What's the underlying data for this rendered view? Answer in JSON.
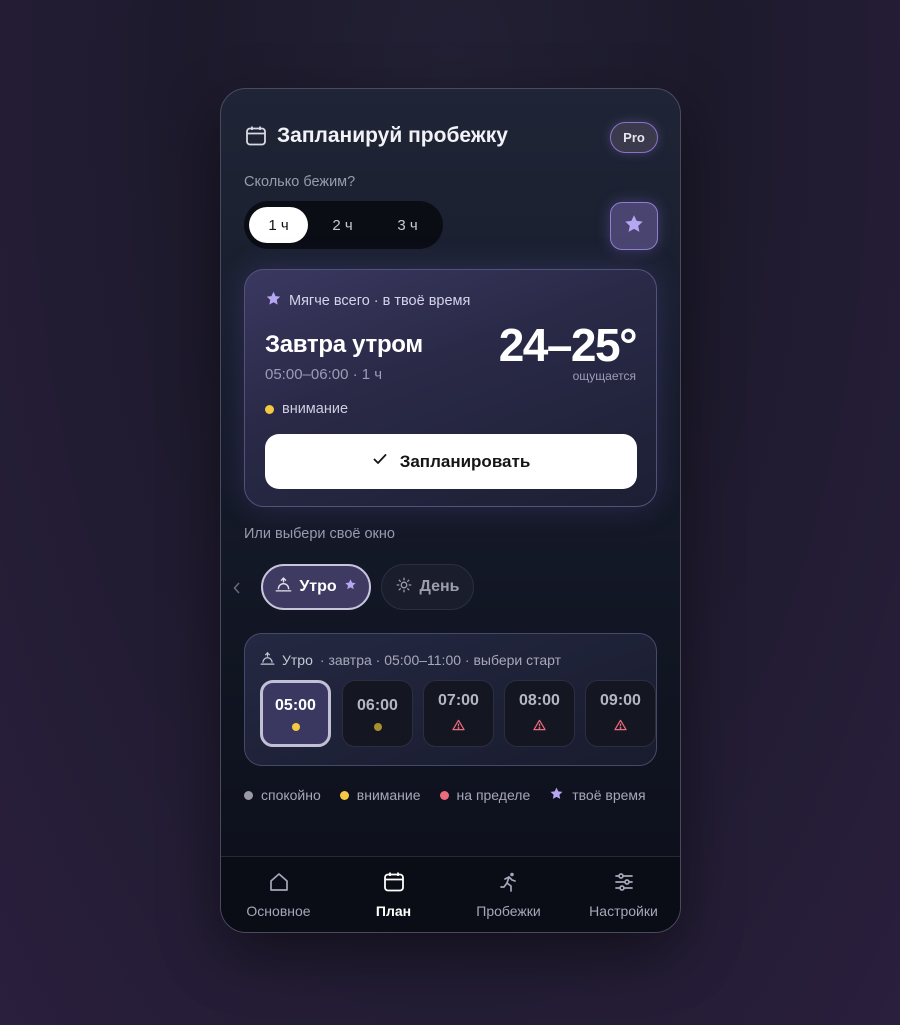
{
  "header": {
    "title": "Запланируй пробежку",
    "badge": "Pro",
    "icon": "calendar-icon"
  },
  "duration": {
    "question": "Сколько бежим?",
    "options": [
      "1 ч",
      "2 ч",
      "3 ч"
    ],
    "selected": "1 ч"
  },
  "recommendation": {
    "heading": "Мягче всего · в твоё время",
    "when": "Завтра утром",
    "time": "05:00–06:00 · 1 ч",
    "temperature": "24–25°",
    "feels_label": "ощущается",
    "status": "внимание",
    "action": "Запланировать"
  },
  "window_picker": {
    "label": "Или выбери своё окно",
    "tabs": [
      {
        "label": "Утро",
        "icon": "sunrise-icon",
        "selected": true
      },
      {
        "label": "День",
        "icon": "sun-icon",
        "selected": false
      }
    ]
  },
  "slots": {
    "period": "Утро",
    "subtitle": "· завтра · 05:00–11:00 · выбери старт",
    "items": [
      {
        "time": "05:00",
        "status": "внимание",
        "selected": true
      },
      {
        "time": "06:00",
        "status": "внимание",
        "selected": false
      },
      {
        "time": "07:00",
        "status": "на пределе",
        "selected": false
      },
      {
        "time": "08:00",
        "status": "на пределе",
        "selected": false
      },
      {
        "time": "09:00",
        "status": "на пределе",
        "selected": false
      }
    ]
  },
  "legend": [
    {
      "label": "спокойно",
      "color": "#9a9aa6"
    },
    {
      "label": "внимание",
      "color": "#f5c842"
    },
    {
      "label": "на пределе",
      "color": "#ee6b7d"
    },
    {
      "label": "твоё время",
      "color": "#b7a6f2"
    }
  ],
  "nav": {
    "items": [
      {
        "label": "Основное",
        "icon": "home-icon"
      },
      {
        "label": "План",
        "icon": "calendar-icon"
      },
      {
        "label": "Пробежки",
        "icon": "runner-icon"
      },
      {
        "label": "Настройки",
        "icon": "sliders-icon"
      }
    ],
    "active": "План"
  },
  "colors": {
    "accent": "#8f7fd0",
    "attention": "#f5c842",
    "limit": "#ee6b7d",
    "your_time": "#b7a6f2"
  }
}
